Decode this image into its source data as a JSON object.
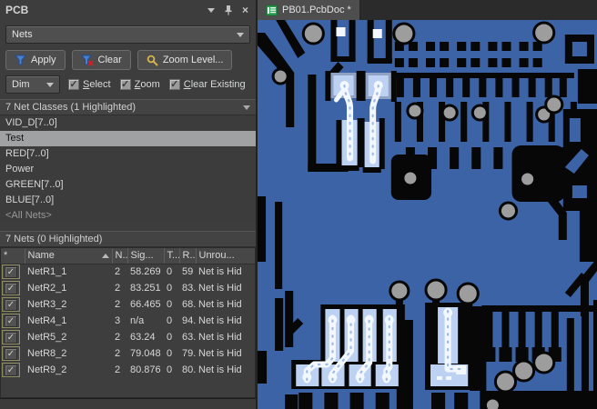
{
  "colors": {
    "copper_blue": "#3b63a6",
    "board_black": "#070707",
    "via_gray": "#9d9d9d",
    "highlight_pad": "#bdd1f3",
    "highlight_trace": "#f3f8ff",
    "pad_frame": "#8fa2c4",
    "trace_dot": "#9fbbe8",
    "funnel_blue": "#4a7fd0",
    "magnifier_gold": "#d8b44a",
    "tab_icon_green": "#2e9e52"
  },
  "panel": {
    "title": "PCB",
    "header_icons": [
      "chevron-down",
      "pin",
      "close"
    ],
    "mode_select": {
      "value": "Nets"
    },
    "toolbar": {
      "apply_label": "Apply",
      "clear_label": "Clear",
      "zoom_level_label": "Zoom Level..."
    },
    "dim_row": {
      "value": "Dim",
      "checkboxes": [
        {
          "label": "Select",
          "checked": true
        },
        {
          "label": "Zoom",
          "checked": true
        },
        {
          "label": "Clear Existing",
          "checked": true
        }
      ]
    },
    "net_classes": {
      "header": "7 Net Classes (1 Highlighted)",
      "items": [
        {
          "label": "VID_D[7..0]",
          "state": "normal"
        },
        {
          "label": "Test",
          "state": "selected"
        },
        {
          "label": "RED[7..0]",
          "state": "normal"
        },
        {
          "label": "Power",
          "state": "normal"
        },
        {
          "label": "GREEN[7..0]",
          "state": "normal"
        },
        {
          "label": "BLUE[7..0]",
          "state": "normal"
        },
        {
          "label": "<All Nets>",
          "state": "dim"
        }
      ]
    },
    "nets": {
      "header": "7 Nets (0 Highlighted)",
      "columns": [
        "*",
        "Name",
        "N..",
        "Sig...",
        "T...",
        "R...",
        "Unrou..."
      ],
      "rows": [
        {
          "checked": true,
          "name": "NetR1_1",
          "n": "2",
          "sig": "58.269",
          "t": "0",
          "r": "59",
          "unrouted": "Net is Hid"
        },
        {
          "checked": true,
          "name": "NetR2_1",
          "n": "2",
          "sig": "83.251",
          "t": "0",
          "r": "83.",
          "unrouted": "Net is Hid"
        },
        {
          "checked": true,
          "name": "NetR3_2",
          "n": "2",
          "sig": "66.465",
          "t": "0",
          "r": "68.",
          "unrouted": "Net is Hid"
        },
        {
          "checked": true,
          "name": "NetR4_1",
          "n": "3",
          "sig": "n/a",
          "t": "0",
          "r": "94.",
          "unrouted": "Net is Hid"
        },
        {
          "checked": true,
          "name": "NetR5_2",
          "n": "2",
          "sig": "63.24",
          "t": "0",
          "r": "63.",
          "unrouted": "Net is Hid"
        },
        {
          "checked": true,
          "name": "NetR8_2",
          "n": "2",
          "sig": "79.048",
          "t": "0",
          "r": "79.",
          "unrouted": "Net is Hid"
        },
        {
          "checked": true,
          "name": "NetR9_2",
          "n": "2",
          "sig": "80.876",
          "t": "0",
          "r": "80.",
          "unrouted": "Net is Hid"
        }
      ]
    }
  },
  "editor": {
    "tab_label": "PB01.PcbDoc *"
  }
}
